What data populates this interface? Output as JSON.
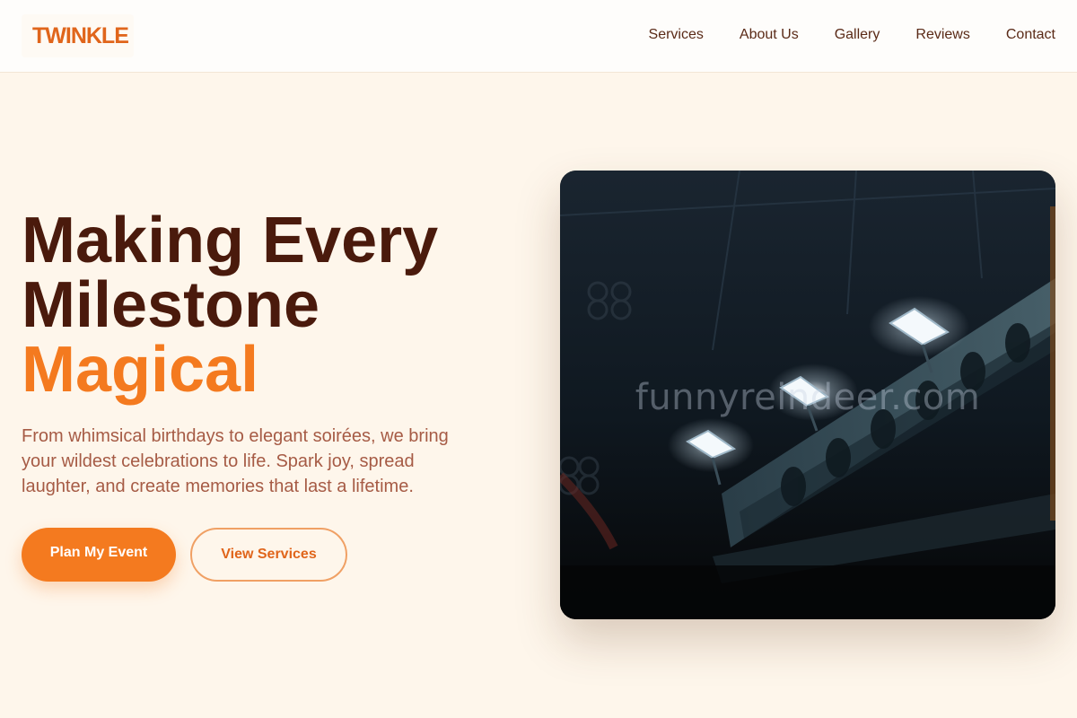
{
  "brand": {
    "logo_text": "TWINKLE",
    "accent_color": "#f47a1f",
    "dark_color": "#4a1a0c"
  },
  "nav": {
    "items": [
      "Services",
      "About Us",
      "Gallery",
      "Reviews",
      "Contact"
    ]
  },
  "hero": {
    "title_line1": "Making Every",
    "title_line2": "Milestone",
    "title_accent": "Magical",
    "subtitle": "From whimsical birthdays to elegant soirées, we bring your wildest celebrations to life. Spark joy, spread laughter, and create memories that last a lifetime.",
    "primary_button": "Plan My Event",
    "secondary_button": "View Services",
    "image": {
      "watermark": "funnyreindeer.com"
    }
  }
}
